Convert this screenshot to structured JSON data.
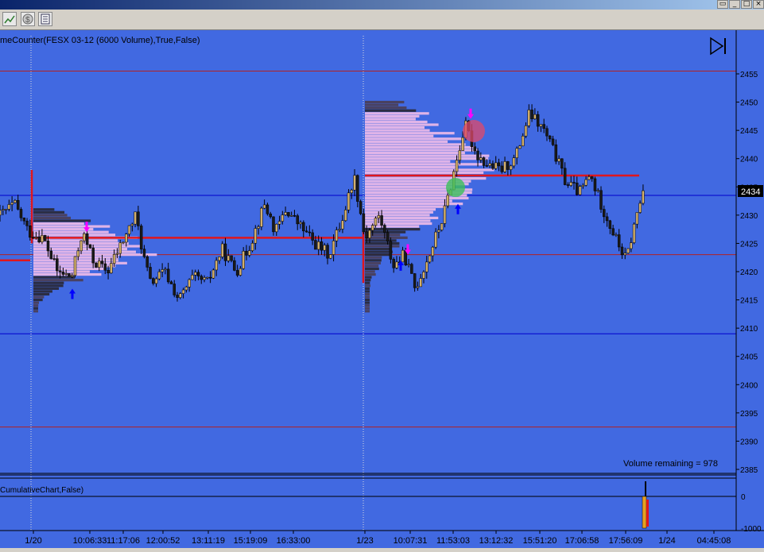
{
  "window": {
    "controls": [
      "▭",
      "_",
      "□",
      "×"
    ]
  },
  "toolbar": {
    "icons": [
      "chart-icon",
      "dollar-icon",
      "properties-icon"
    ]
  },
  "indicator_label": "meCounter(FESX 03-12 (6000 Volume),True,False)",
  "lower_panel_label": "CumulativeChart,False)",
  "volume_remaining": "Volume remaining = 978",
  "price_marker": "2434",
  "colors": {
    "background": "#4169e1",
    "candle_up": "#d4b06a",
    "candle_down": "#1a1a1a",
    "poc_line": "#e0161d",
    "profile_light": "#e8b8e8",
    "profile_dark": "#2a2a3a",
    "hline_red": "#b22222",
    "hline_blue": "#0000cd",
    "up_arrow": "#0000ff",
    "down_arrow": "#ff00ff"
  },
  "chart_data": [
    {
      "type": "candlestick",
      "description_axis": "price",
      "y_ticks": [
        2385,
        2390,
        2395,
        2400,
        2405,
        2410,
        2415,
        2420,
        2425,
        2430,
        2435,
        2440,
        2445,
        2450,
        2455
      ],
      "ylim": [
        2383,
        2458
      ],
      "x_tick_labels": [
        "1/20",
        "10:06:33",
        "11:17:06",
        "12:00:52",
        "13:11:19",
        "15:19:09",
        "16:33:00",
        "1/23",
        "10:07:31",
        "11:53:03",
        "13:12:32",
        "15:51:20",
        "17:06:58",
        "17:56:09",
        "1/24",
        "04:45:08"
      ],
      "horizontal_lines": [
        {
          "price": 2455.5,
          "color": "red"
        },
        {
          "price": 2433.5,
          "color": "blue"
        },
        {
          "price": 2423,
          "color": "red"
        },
        {
          "price": 2409,
          "color": "blue"
        },
        {
          "price": 2392.5,
          "color": "red"
        },
        {
          "price": 2384.3,
          "color": "black"
        }
      ],
      "poc_lines": [
        {
          "price": 2426,
          "from_time": "1/20",
          "to_time": "1/23"
        },
        {
          "price": 2437,
          "from_time": "1/23",
          "to_time": "17:56:09"
        }
      ],
      "series_path": [
        [
          0,
          2430
        ],
        [
          0.02,
          2432
        ],
        [
          0.04,
          2427
        ],
        [
          0.06,
          2426
        ],
        [
          0.08,
          2420
        ],
        [
          0.1,
          2419
        ],
        [
          0.115,
          2427
        ],
        [
          0.13,
          2422
        ],
        [
          0.15,
          2420
        ],
        [
          0.17,
          2425
        ],
        [
          0.19,
          2430
        ],
        [
          0.2,
          2423
        ],
        [
          0.21,
          2418
        ],
        [
          0.23,
          2420
        ],
        [
          0.25,
          2415
        ],
        [
          0.27,
          2419
        ],
        [
          0.29,
          2418
        ],
        [
          0.31,
          2424
        ],
        [
          0.33,
          2420
        ],
        [
          0.35,
          2425
        ],
        [
          0.37,
          2432
        ],
        [
          0.385,
          2427
        ],
        [
          0.4,
          2431
        ],
        [
          0.42,
          2428
        ],
        [
          0.44,
          2425
        ],
        [
          0.46,
          2423
        ],
        [
          0.48,
          2430
        ],
        [
          0.495,
          2437
        ],
        [
          0.51,
          2426
        ],
        [
          0.53,
          2430
        ],
        [
          0.55,
          2421
        ],
        [
          0.565,
          2423
        ],
        [
          0.58,
          2417
        ],
        [
          0.6,
          2423
        ],
        [
          0.62,
          2430
        ],
        [
          0.635,
          2438
        ],
        [
          0.65,
          2446
        ],
        [
          0.665,
          2441
        ],
        [
          0.68,
          2439
        ],
        [
          0.7,
          2438
        ],
        [
          0.72,
          2440
        ],
        [
          0.74,
          2448
        ],
        [
          0.76,
          2445
        ],
        [
          0.775,
          2441
        ],
        [
          0.79,
          2436
        ],
        [
          0.81,
          2434
        ],
        [
          0.825,
          2437
        ],
        [
          0.84,
          2432
        ],
        [
          0.86,
          2426
        ],
        [
          0.875,
          2422
        ],
        [
          0.89,
          2430
        ],
        [
          0.9,
          2435
        ]
      ],
      "volume_profiles": [
        {
          "session": "1/20",
          "price_low": 2413,
          "price_high": 2431
        },
        {
          "session": "1/23",
          "price_low": 2413,
          "price_high": 2450
        }
      ],
      "signals": [
        {
          "type": "up",
          "price": 2416
        },
        {
          "type": "down",
          "price": 2428
        },
        {
          "type": "up",
          "price": 2421
        },
        {
          "type": "down",
          "price": 2424
        },
        {
          "type": "up",
          "price": 2431
        },
        {
          "type": "down",
          "price": 2448
        }
      ]
    },
    {
      "type": "bar",
      "description_axis": "cumulative",
      "y_ticks": [
        0,
        -1000
      ],
      "ylim": [
        -1100,
        400
      ],
      "values": [
        -1000
      ]
    }
  ]
}
